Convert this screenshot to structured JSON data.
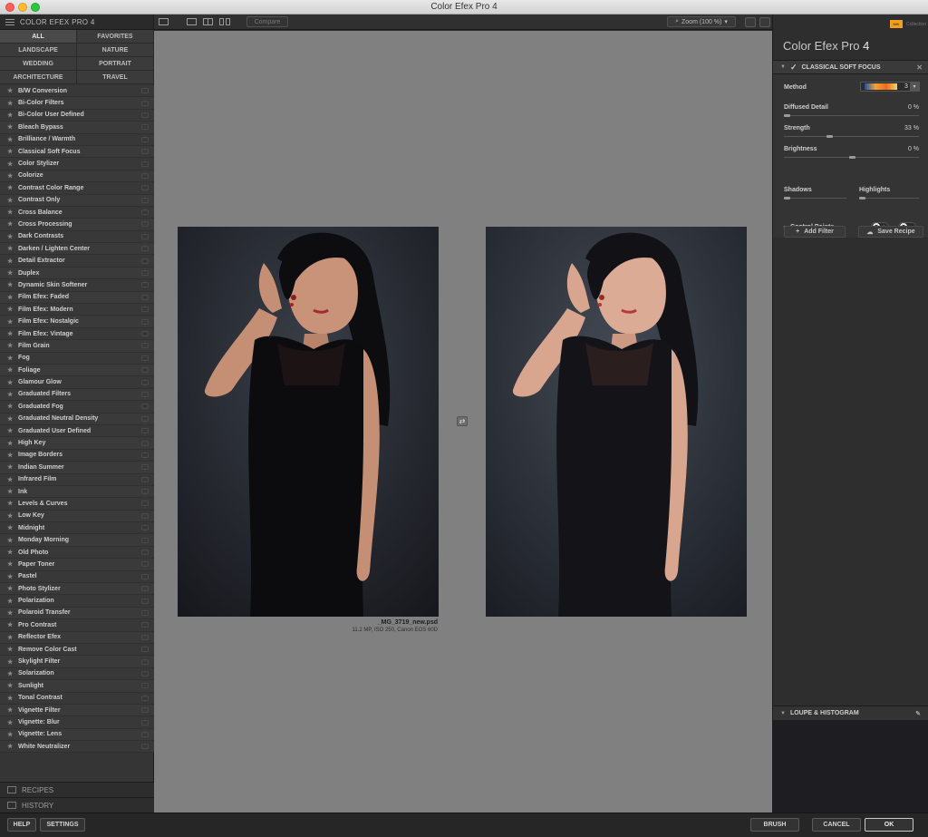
{
  "window": {
    "title": "Color Efex Pro 4"
  },
  "left_panel": {
    "header": "COLOR EFEX PRO 4",
    "categories": [
      "ALL",
      "FAVORITES",
      "LANDSCAPE",
      "NATURE",
      "WEDDING",
      "PORTRAIT",
      "ARCHITECTURE",
      "TRAVEL"
    ],
    "active_category": "ALL",
    "filters": [
      "B/W Conversion",
      "Bi-Color Filters",
      "Bi-Color User Defined",
      "Bleach Bypass",
      "Brilliance / Warmth",
      "Classical Soft Focus",
      "Color Stylizer",
      "Colorize",
      "Contrast Color Range",
      "Contrast Only",
      "Cross Balance",
      "Cross Processing",
      "Dark Contrasts",
      "Darken / Lighten Center",
      "Detail Extractor",
      "Duplex",
      "Dynamic Skin Softener",
      "Film Efex: Faded",
      "Film Efex: Modern",
      "Film Efex: Nostalgic",
      "Film Efex: Vintage",
      "Film Grain",
      "Fog",
      "Foliage",
      "Glamour Glow",
      "Graduated Filters",
      "Graduated Fog",
      "Graduated Neutral Density",
      "Graduated User Defined",
      "High Key",
      "Image Borders",
      "Indian Summer",
      "Infrared Film",
      "Ink",
      "Levels & Curves",
      "Low Key",
      "Midnight",
      "Monday Morning",
      "Old Photo",
      "Paper Toner",
      "Pastel",
      "Photo Stylizer",
      "Polarization",
      "Polaroid Transfer",
      "Pro Contrast",
      "Reflector Efex",
      "Remove Color Cast",
      "Skylight Filter",
      "Solarization",
      "Sunlight",
      "Tonal Contrast",
      "Vignette Filter",
      "Vignette: Blur",
      "Vignette: Lens",
      "White Neutralizer"
    ],
    "recipes_label": "RECIPES",
    "history_label": "HISTORY"
  },
  "toolbar": {
    "compare_label": "Compare",
    "zoom_label": "Zoom (100 %)"
  },
  "preview": {
    "file_name": "_MG_3719_new.psd",
    "file_meta": "11.2 MP, ISO 250, Canon EOS 60D"
  },
  "right_panel": {
    "brand_badge": "NIK",
    "brand_sub": "Collection",
    "product_name": "Color Efex Pro",
    "product_version": "4",
    "active_filter": "CLASSICAL SOFT FOCUS",
    "method_label": "Method",
    "method_value": "3",
    "params": [
      {
        "label": "Diffused Detail",
        "value": "0 %",
        "level": 0.0
      },
      {
        "label": "Strength",
        "value": "33 %",
        "level": 0.33
      },
      {
        "label": "Brightness",
        "value": "0 %",
        "level": 0.5
      }
    ],
    "shadows_label": "Shadows",
    "highlights_label": "Highlights",
    "control_points_label": "Control Points",
    "add_filter_label": "Add Filter",
    "save_recipe_label": "Save Recipe",
    "loupe_label": "LOUPE & HISTOGRAM"
  },
  "bottom_bar": {
    "help": "HELP",
    "settings": "SETTINGS",
    "brush": "BRUSH",
    "cancel": "CANCEL",
    "ok": "OK"
  }
}
